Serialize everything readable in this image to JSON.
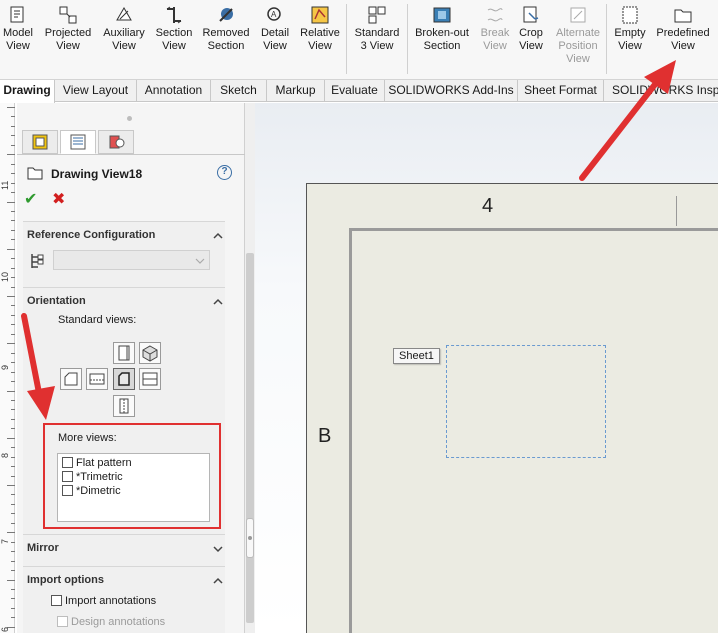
{
  "ribbon": {
    "buttons": [
      {
        "label1": "Model",
        "label2": "View",
        "icon": "model-view-icon"
      },
      {
        "label1": "Projected",
        "label2": "View",
        "icon": "projected-view-icon"
      },
      {
        "label1": "Auxiliary",
        "label2": "View",
        "icon": "auxiliary-view-icon"
      },
      {
        "label1": "Section",
        "label2": "View",
        "icon": "section-view-icon"
      },
      {
        "label1": "Removed",
        "label2": "Section",
        "icon": "removed-section-icon"
      },
      {
        "label1": "Detail",
        "label2": "View",
        "icon": "detail-view-icon"
      },
      {
        "label1": "Relative",
        "label2": "View",
        "icon": "relative-view-icon"
      },
      {
        "label1": "Standard",
        "label2": "3 View",
        "icon": "standard-3-view-icon"
      },
      {
        "label1": "Broken-out",
        "label2": "Section",
        "icon": "broken-out-section-icon"
      },
      {
        "label1": "Break",
        "label2": "View",
        "icon": "break-view-icon",
        "disabled": true
      },
      {
        "label1": "Crop",
        "label2": "View",
        "icon": "crop-view-icon"
      },
      {
        "label1": "Alternate",
        "label2": "Position",
        "label3": "View",
        "icon": "alternate-position-view-icon",
        "disabled": true
      },
      {
        "label1": "Empty",
        "label2": "View",
        "icon": "empty-view-icon"
      },
      {
        "label1": "Predefined",
        "label2": "View",
        "icon": "predefined-view-icon"
      }
    ]
  },
  "tabs": [
    {
      "label": "Drawing",
      "active": true
    },
    {
      "label": "View Layout"
    },
    {
      "label": "Annotation"
    },
    {
      "label": "Sketch"
    },
    {
      "label": "Markup"
    },
    {
      "label": "Evaluate"
    },
    {
      "label": "SOLIDWORKS Add-Ins"
    },
    {
      "label": "Sheet Format"
    },
    {
      "label": "SOLIDWORKS Inspec"
    }
  ],
  "ruler": {
    "numbers": [
      "11",
      "10",
      "9",
      "8",
      "7",
      "6"
    ]
  },
  "property_manager": {
    "title": "Drawing View18",
    "help_icon": "?",
    "ok_glyph": "✔",
    "cancel_glyph": "✖",
    "reference_configuration": {
      "title": "Reference Configuration",
      "selected_value": ""
    },
    "orientation": {
      "title": "Orientation",
      "standard_views_label": "Standard views:",
      "more_views_label": "More views:",
      "more_views": [
        {
          "label": "Flat pattern",
          "checked": false
        },
        {
          "label": "*Trimetric",
          "checked": false
        },
        {
          "label": "*Dimetric",
          "checked": false
        }
      ]
    },
    "mirror": {
      "title": "Mirror"
    },
    "import_options": {
      "title": "Import options",
      "import_annotations": "Import annotations",
      "design_annotations": "Design annotations"
    }
  },
  "drawing": {
    "zone_column": "4",
    "zone_row": "B",
    "sheet_label": "Sheet1"
  },
  "colors": {
    "annotation_arrow": "#e03030",
    "ok": "#2f9a2f",
    "cancel": "#d21f1f"
  }
}
